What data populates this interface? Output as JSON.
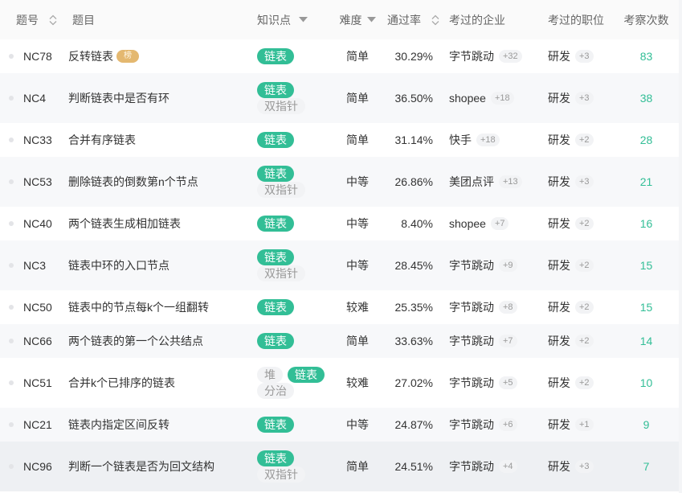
{
  "colors": {
    "accent": "#32be96",
    "hot_badge": "#e4b870",
    "row_alt": "#f7f8fa",
    "row_hover": "#eef0f3"
  },
  "icons": {
    "sort": "sort-icon",
    "filter": "caret-down-icon",
    "status": "status-dot"
  },
  "header": {
    "id": "题号",
    "title": "题目",
    "tags": "知识点",
    "difficulty": "难度",
    "pass_rate": "通过率",
    "companies": "考过的企业",
    "positions": "考过的职位",
    "count": "考察次数"
  },
  "rows": [
    {
      "id": "NC78",
      "title": "反转链表",
      "badge": "榜",
      "tags": [
        {
          "label": "链表",
          "active": true
        }
      ],
      "difficulty": "简单",
      "pass_rate": "30.29%",
      "company": "字节跳动",
      "company_more": "+32",
      "position": "研发",
      "position_more": "+3",
      "count": "83"
    },
    {
      "id": "NC4",
      "title": "判断链表中是否有环",
      "tags": [
        {
          "label": "链表",
          "active": true
        },
        {
          "label": "双指针",
          "active": false
        }
      ],
      "difficulty": "简单",
      "pass_rate": "36.50%",
      "company": "shopee",
      "company_more": "+18",
      "position": "研发",
      "position_more": "+3",
      "count": "38"
    },
    {
      "id": "NC33",
      "title": "合并有序链表",
      "tags": [
        {
          "label": "链表",
          "active": true
        }
      ],
      "difficulty": "简单",
      "pass_rate": "31.14%",
      "company": "快手",
      "company_more": "+18",
      "position": "研发",
      "position_more": "+2",
      "count": "28"
    },
    {
      "id": "NC53",
      "title": "删除链表的倒数第n个节点",
      "tags": [
        {
          "label": "链表",
          "active": true
        },
        {
          "label": "双指针",
          "active": false
        }
      ],
      "difficulty": "中等",
      "pass_rate": "26.86%",
      "company": "美团点评",
      "company_more": "+13",
      "position": "研发",
      "position_more": "+3",
      "count": "21"
    },
    {
      "id": "NC40",
      "title": "两个链表生成相加链表",
      "tags": [
        {
          "label": "链表",
          "active": true
        }
      ],
      "difficulty": "中等",
      "pass_rate": "8.40%",
      "company": "shopee",
      "company_more": "+7",
      "position": "研发",
      "position_more": "+2",
      "count": "16"
    },
    {
      "id": "NC3",
      "title": "链表中环的入口节点",
      "tags": [
        {
          "label": "链表",
          "active": true
        },
        {
          "label": "双指针",
          "active": false
        }
      ],
      "difficulty": "中等",
      "pass_rate": "28.45%",
      "company": "字节跳动",
      "company_more": "+9",
      "position": "研发",
      "position_more": "+2",
      "count": "15"
    },
    {
      "id": "NC50",
      "title": "链表中的节点每k个一组翻转",
      "tags": [
        {
          "label": "链表",
          "active": true
        }
      ],
      "difficulty": "较难",
      "pass_rate": "25.35%",
      "company": "字节跳动",
      "company_more": "+8",
      "position": "研发",
      "position_more": "+2",
      "count": "15"
    },
    {
      "id": "NC66",
      "title": "两个链表的第一个公共结点",
      "tags": [
        {
          "label": "链表",
          "active": true
        }
      ],
      "difficulty": "简单",
      "pass_rate": "33.63%",
      "company": "字节跳动",
      "company_more": "+7",
      "position": "研发",
      "position_more": "+2",
      "count": "14"
    },
    {
      "id": "NC51",
      "title": "合并k个已排序的链表",
      "tags": [
        {
          "label": "堆",
          "active": false
        },
        {
          "label": "链表",
          "active": true
        },
        {
          "label": "分治",
          "active": false
        }
      ],
      "difficulty": "较难",
      "pass_rate": "27.02%",
      "company": "字节跳动",
      "company_more": "+5",
      "position": "研发",
      "position_more": "+2",
      "count": "10"
    },
    {
      "id": "NC21",
      "title": "链表内指定区间反转",
      "tags": [
        {
          "label": "链表",
          "active": true
        }
      ],
      "difficulty": "中等",
      "pass_rate": "24.87%",
      "company": "字节跳动",
      "company_more": "+6",
      "position": "研发",
      "position_more": "+1",
      "count": "9"
    },
    {
      "id": "NC96",
      "title": "判断一个链表是否为回文结构",
      "tags": [
        {
          "label": "链表",
          "active": true
        },
        {
          "label": "双指针",
          "active": false
        }
      ],
      "difficulty": "简单",
      "pass_rate": "24.51%",
      "company": "字节跳动",
      "company_more": "+4",
      "position": "研发",
      "position_more": "+3",
      "count": "7",
      "highlighted": true
    }
  ]
}
